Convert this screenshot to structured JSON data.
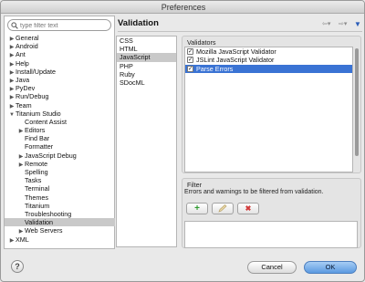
{
  "window": {
    "title": "Preferences"
  },
  "search": {
    "placeholder": "type filter text"
  },
  "tree": {
    "items": [
      {
        "label": "General",
        "twisty": "▶",
        "indent": 0
      },
      {
        "label": "Android",
        "twisty": "▶",
        "indent": 0
      },
      {
        "label": "Ant",
        "twisty": "▶",
        "indent": 0
      },
      {
        "label": "Help",
        "twisty": "▶",
        "indent": 0
      },
      {
        "label": "Install/Update",
        "twisty": "▶",
        "indent": 0
      },
      {
        "label": "Java",
        "twisty": "▶",
        "indent": 0
      },
      {
        "label": "PyDev",
        "twisty": "▶",
        "indent": 0
      },
      {
        "label": "Run/Debug",
        "twisty": "▶",
        "indent": 0
      },
      {
        "label": "Team",
        "twisty": "▶",
        "indent": 0
      },
      {
        "label": "Titanium Studio",
        "twisty": "▼",
        "indent": 0
      },
      {
        "label": "Content Assist",
        "twisty": "",
        "indent": 1
      },
      {
        "label": "Editors",
        "twisty": "▶",
        "indent": 1
      },
      {
        "label": "Find Bar",
        "twisty": "",
        "indent": 1
      },
      {
        "label": "Formatter",
        "twisty": "",
        "indent": 1
      },
      {
        "label": "JavaScript Debug",
        "twisty": "▶",
        "indent": 1
      },
      {
        "label": "Remote",
        "twisty": "▶",
        "indent": 1
      },
      {
        "label": "Spelling",
        "twisty": "",
        "indent": 1
      },
      {
        "label": "Tasks",
        "twisty": "",
        "indent": 1
      },
      {
        "label": "Terminal",
        "twisty": "",
        "indent": 1
      },
      {
        "label": "Themes",
        "twisty": "",
        "indent": 1
      },
      {
        "label": "Titanium",
        "twisty": "",
        "indent": 1
      },
      {
        "label": "Troubleshooting",
        "twisty": "",
        "indent": 1
      },
      {
        "label": "Validation",
        "twisty": "",
        "indent": 1,
        "selected": true
      },
      {
        "label": "Web Servers",
        "twisty": "▶",
        "indent": 1
      },
      {
        "label": "XML",
        "twisty": "▶",
        "indent": 0
      }
    ]
  },
  "page": {
    "title": "Validation"
  },
  "languages": {
    "items": [
      {
        "label": "CSS"
      },
      {
        "label": "HTML"
      },
      {
        "label": "JavaScript",
        "selected": true
      },
      {
        "label": "PHP"
      },
      {
        "label": "Ruby"
      },
      {
        "label": "SDocML"
      }
    ]
  },
  "validators": {
    "label": "Validators",
    "items": [
      {
        "label": "Mozilla JavaScript Validator",
        "checked": true
      },
      {
        "label": "JSLint JavaScript Validator",
        "checked": true
      },
      {
        "label": "Parse Errors",
        "checked": true,
        "selected": true
      }
    ]
  },
  "filter": {
    "label": "Filter",
    "description": "Errors and warnings to be filtered from validation.",
    "add_icon": "plus-icon",
    "edit_icon": "pencil-icon",
    "remove_icon": "x-icon"
  },
  "buttons": {
    "cancel": "Cancel",
    "ok": "OK",
    "help": "?"
  },
  "colors": {
    "selection": "#3a73d4",
    "ok_button": "#5b9ae1",
    "add": "#2e9b2e",
    "remove": "#d23a3a"
  }
}
